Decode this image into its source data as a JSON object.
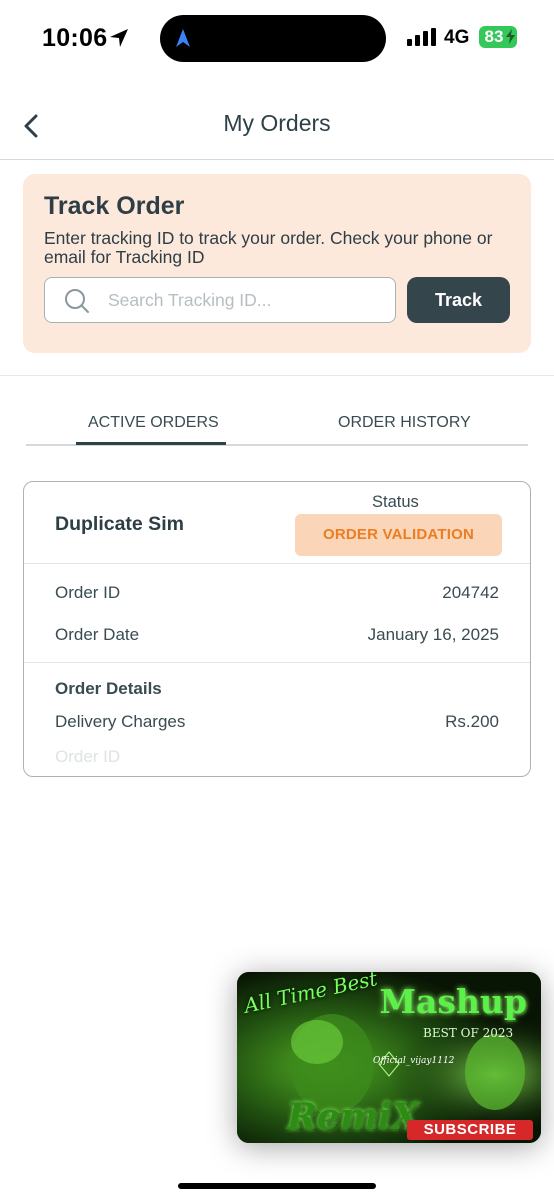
{
  "status_bar": {
    "time": "10:06",
    "network": "4G",
    "battery": "83",
    "icons": [
      "location-arrow-icon",
      "navigation-icon",
      "signal-bars-icon",
      "charging-bolt-icon"
    ],
    "battery_color": "#34c759"
  },
  "header": {
    "title": "My Orders",
    "back_icon": "chevron-left-icon"
  },
  "track_order": {
    "title": "Track Order",
    "description": "Enter tracking ID to track your order. Check your phone or email for Tracking ID",
    "search_placeholder": "Search Tracking ID...",
    "search_value": "",
    "button_label": "Track",
    "background_color": "#fde8dc",
    "button_color": "#34464c"
  },
  "tabs": [
    {
      "label": "ACTIVE ORDERS",
      "active": true
    },
    {
      "label": "ORDER HISTORY",
      "active": false
    }
  ],
  "order": {
    "product": "Duplicate Sim",
    "status_label": "Status",
    "status": "ORDER VALIDATION",
    "status_color": "#ea7e23",
    "status_bg": "#fbd5b8",
    "order_id_label": "Order ID",
    "order_id": "204742",
    "order_date_label": "Order Date",
    "order_date": "January 16, 2025",
    "details_title": "Order Details",
    "delivery_label": "Delivery Charges",
    "delivery_value": "Rs.200",
    "faded_label": "Order ID"
  },
  "video_pip": {
    "title_top": "All Time Best",
    "title_main": "Mashup",
    "subtitle": "BEST OF 2023",
    "handle": "Official_vijay1112",
    "remix": "RemiX",
    "subscribe": "SUBSCRIBE"
  }
}
